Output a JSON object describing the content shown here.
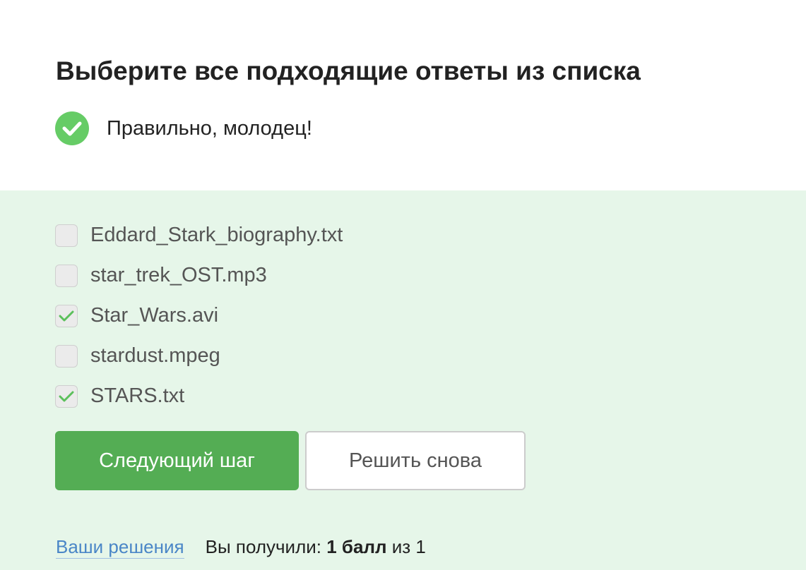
{
  "question": {
    "title": "Выберите все подходящие ответы из списка"
  },
  "feedback": {
    "icon": "check-circle-icon",
    "text": "Правильно, молодец!",
    "color": "#66cc66"
  },
  "options": [
    {
      "label": "Eddard_Stark_biography.txt",
      "checked": false
    },
    {
      "label": "star_trek_OST.mp3",
      "checked": false
    },
    {
      "label": "Star_Wars.avi",
      "checked": true
    },
    {
      "label": "stardust.mpeg",
      "checked": false
    },
    {
      "label": "STARS.txt",
      "checked": true
    }
  ],
  "buttons": {
    "next_label": "Следующий шаг",
    "retry_label": "Решить снова"
  },
  "footer": {
    "solutions_link": "Ваши решения",
    "score_prefix": "Вы получили:",
    "score_value": "1 балл",
    "score_suffix": "из 1"
  },
  "colors": {
    "accent": "#54ad54",
    "answer_background": "#e6f6e9",
    "link": "#4a86c7"
  }
}
